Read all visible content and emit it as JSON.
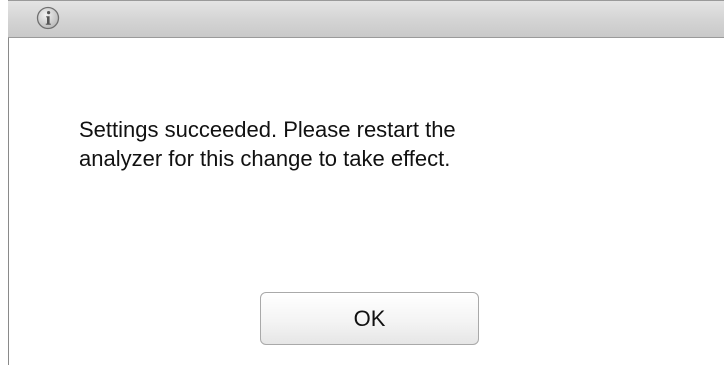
{
  "dialog": {
    "title_icon": "info-icon",
    "message_lines": [
      "Settings succeeded. Please restart the",
      "analyzer for this change to take effect."
    ],
    "ok_label": "OK"
  },
  "colors": {
    "titlebar": "#d5d5d5",
    "border": "#8a8a8a",
    "text": "#111111",
    "background": "#ffffff"
  }
}
